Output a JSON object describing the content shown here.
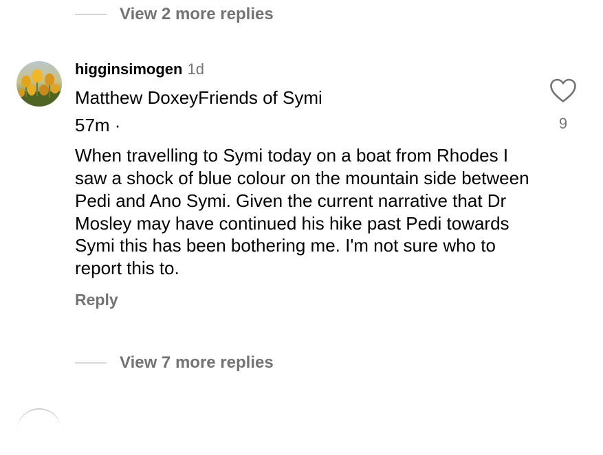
{
  "replies_top": {
    "label": "View 2 more replies"
  },
  "comment": {
    "username": "higginsimogen",
    "time_ago": "1d",
    "avatar_icon": "tulip-field-avatar",
    "body": {
      "line1": "Matthew DoxeyFriends of Symi",
      "line2": "57m ·",
      "paragraph": "When travelling to Symi today on a boat from Rhodes I saw a shock of blue colour on the mountain side between Pedi and Ano Symi. Given the current narrative that Dr Mosley may have continued his hike past Pedi towards Symi this has been bothering me. I'm not sure who to report this to."
    },
    "reply_label": "Reply",
    "like_icon": "heart-outline-icon",
    "like_count": "9"
  },
  "replies_bottom": {
    "label": "View 7 more replies"
  },
  "colors": {
    "secondary_text": "#737373",
    "primary_text": "#000000",
    "divider": "#d6d6d6"
  }
}
